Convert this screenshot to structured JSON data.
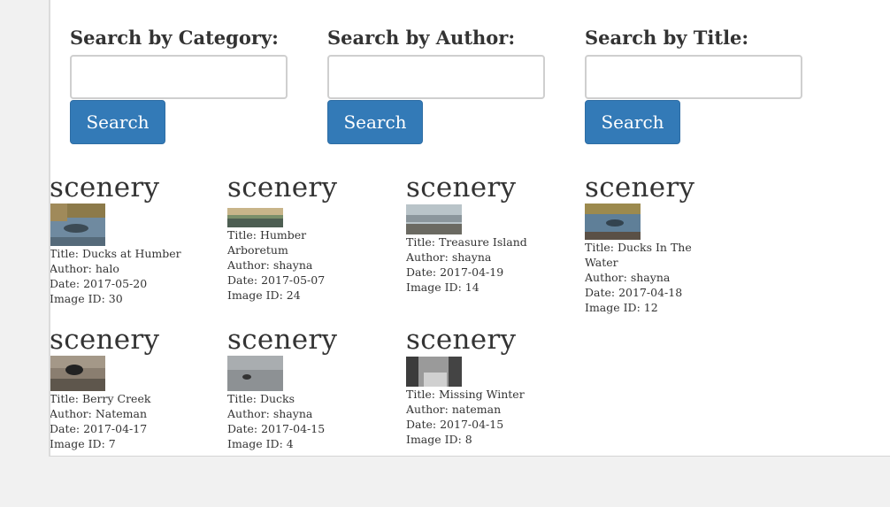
{
  "search": {
    "category": {
      "label": "Search by Category:",
      "value": "",
      "button": "Search"
    },
    "author": {
      "label": "Search by Author:",
      "value": "",
      "button": "Search"
    },
    "title": {
      "label": "Search by Title:",
      "value": "",
      "button": "Search"
    }
  },
  "fields": {
    "title": "Title: ",
    "author": "Author: ",
    "date": "Date: ",
    "image_id": "Image ID: "
  },
  "results": [
    {
      "category": "scenery",
      "title": "Ducks at Humber",
      "author": "halo",
      "date": "2017-05-20",
      "image_id": "30"
    },
    {
      "category": "scenery",
      "title": "Humber Arboretum",
      "author": "shayna",
      "date": "2017-05-07",
      "image_id": "24"
    },
    {
      "category": "scenery",
      "title": "Treasure Island",
      "author": "shayna",
      "date": "2017-04-19",
      "image_id": "14"
    },
    {
      "category": "scenery",
      "title": "Ducks In The Water",
      "author": "shayna",
      "date": "2017-04-18",
      "image_id": "12"
    },
    {
      "category": "scenery",
      "title": "Berry Creek",
      "author": "Nateman",
      "date": "2017-04-17",
      "image_id": "7"
    },
    {
      "category": "scenery",
      "title": "Ducks",
      "author": "shayna",
      "date": "2017-04-15",
      "image_id": "4"
    },
    {
      "category": "scenery",
      "title": "Missing Winter",
      "author": "nateman",
      "date": "2017-04-15",
      "image_id": "8"
    }
  ]
}
